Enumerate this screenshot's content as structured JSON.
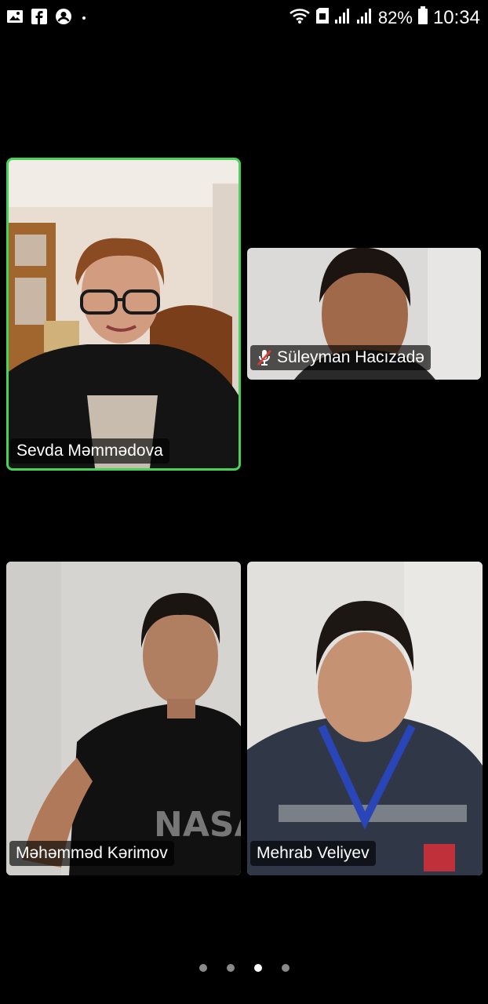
{
  "status_bar": {
    "left_icons": [
      "gallery-icon",
      "facebook-icon",
      "account-icon",
      "dot-icon"
    ],
    "right_icons": [
      "wifi-icon",
      "sim-icon",
      "signal-icon",
      "signal-icon",
      "battery-icon"
    ],
    "battery_percent": "82%",
    "time": "10:34"
  },
  "participants": [
    {
      "name": "Sevda Məmmədova",
      "active_speaker": true,
      "muted": false
    },
    {
      "name": "Süleyman Hacızadə",
      "active_speaker": false,
      "muted": true
    },
    {
      "name": "Məhəmməd Kərimov",
      "active_speaker": false,
      "muted": false
    },
    {
      "name": "Mehrab Veliyev",
      "active_speaker": false,
      "muted": false
    }
  ],
  "pager": {
    "total_pages": 4,
    "current_page": 3
  },
  "colors": {
    "active_border": "#46d35a",
    "background": "#000000"
  }
}
